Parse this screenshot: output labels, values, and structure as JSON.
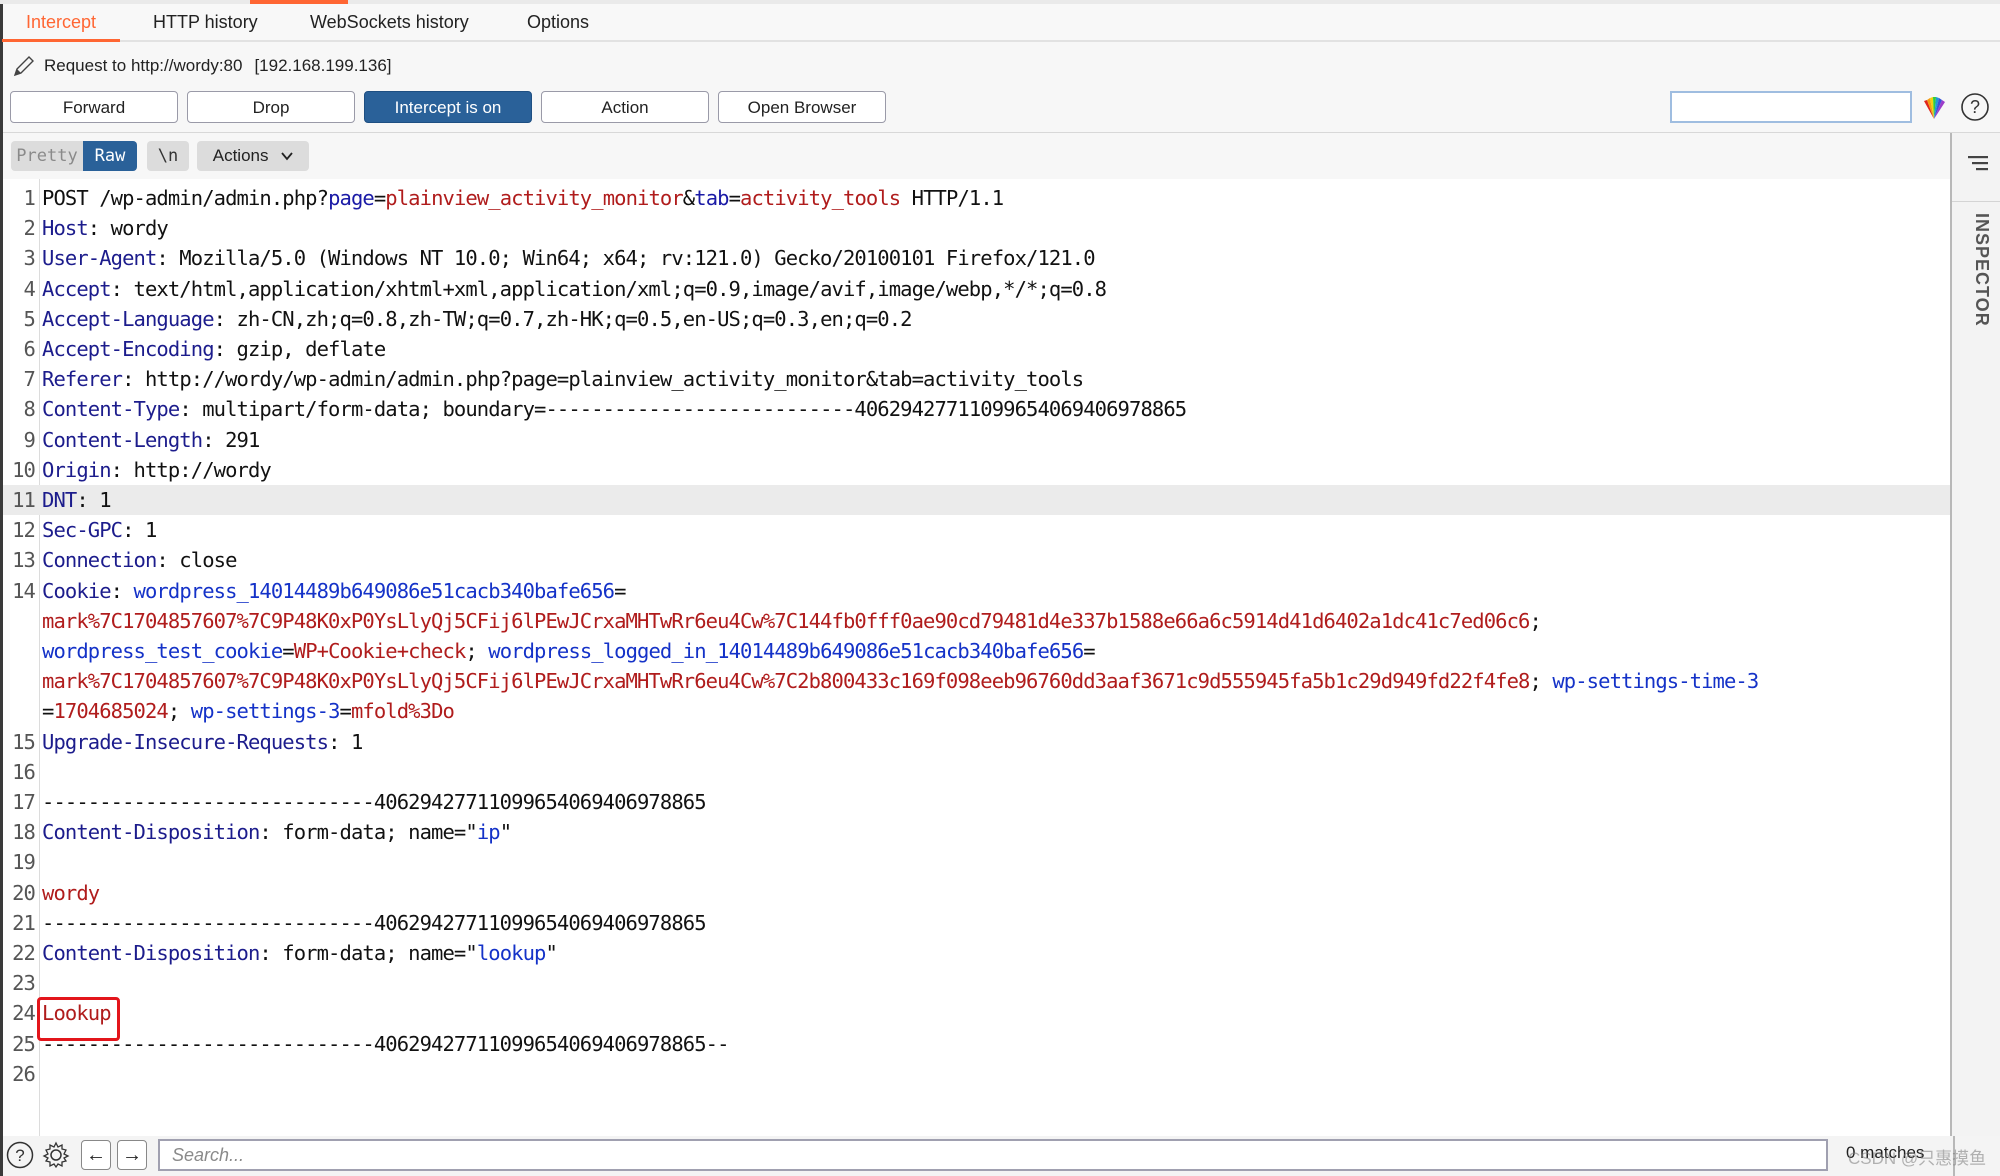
{
  "tabs": [
    {
      "label": "Intercept",
      "active": true
    },
    {
      "label": "HTTP history",
      "active": false
    },
    {
      "label": "WebSockets history",
      "active": false
    },
    {
      "label": "Options",
      "active": false
    }
  ],
  "request_info": {
    "label": "Request to http://wordy:80",
    "ip": "[192.168.199.136]"
  },
  "toolbar": {
    "forward": "Forward",
    "drop": "Drop",
    "intercept": "Intercept is on",
    "action": "Action",
    "open_browser": "Open Browser",
    "search_value": ""
  },
  "editor_toolbar": {
    "pretty": "Pretty",
    "raw": "Raw",
    "newline": "\\n",
    "actions": "Actions"
  },
  "lines": [
    {
      "n": "1",
      "segs": [
        [
          "dk",
          "POST /wp-admin/admin.php?"
        ],
        [
          "k",
          "page"
        ],
        [
          "dk",
          "="
        ],
        [
          "v",
          "plainview_activity_monitor"
        ],
        [
          "dk",
          "&"
        ],
        [
          "k",
          "tab"
        ],
        [
          "dk",
          "="
        ],
        [
          "v",
          "activity_tools"
        ],
        [
          "dk",
          " HTTP/1.1"
        ]
      ]
    },
    {
      "n": "2",
      "segs": [
        [
          "n",
          "Host"
        ],
        [
          "dk",
          ": wordy"
        ]
      ]
    },
    {
      "n": "3",
      "segs": [
        [
          "n",
          "User-Agent"
        ],
        [
          "dk",
          ": Mozilla/5.0 (Windows NT 10.0; Win64; x64; rv:121.0) Gecko/20100101 Firefox/121.0"
        ]
      ]
    },
    {
      "n": "4",
      "segs": [
        [
          "n",
          "Accept"
        ],
        [
          "dk",
          ": text/html,application/xhtml+xml,application/xml;q=0.9,image/avif,image/webp,*/*;q=0.8"
        ]
      ]
    },
    {
      "n": "5",
      "segs": [
        [
          "n",
          "Accept-Language"
        ],
        [
          "dk",
          ": zh-CN,zh;q=0.8,zh-TW;q=0.7,zh-HK;q=0.5,en-US;q=0.3,en;q=0.2"
        ]
      ]
    },
    {
      "n": "6",
      "segs": [
        [
          "n",
          "Accept-Encoding"
        ],
        [
          "dk",
          ": gzip, deflate"
        ]
      ]
    },
    {
      "n": "7",
      "segs": [
        [
          "n",
          "Referer"
        ],
        [
          "dk",
          ": http://wordy/wp-admin/admin.php?page=plainview_activity_monitor&tab=activity_tools"
        ]
      ]
    },
    {
      "n": "8",
      "segs": [
        [
          "n",
          "Content-Type"
        ],
        [
          "dk",
          ": multipart/form-data; boundary=---------------------------406294277110996540694069788​65"
        ]
      ]
    },
    {
      "n": "9",
      "segs": [
        [
          "n",
          "Content-Length"
        ],
        [
          "dk",
          ": 291"
        ]
      ]
    },
    {
      "n": "10",
      "segs": [
        [
          "n",
          "Origin"
        ],
        [
          "dk",
          ": http://wordy"
        ]
      ]
    },
    {
      "n": "11",
      "segs": [
        [
          "n",
          "DNT"
        ],
        [
          "dk",
          ": 1"
        ]
      ],
      "highlight": true
    },
    {
      "n": "12",
      "segs": [
        [
          "n",
          "Sec-GPC"
        ],
        [
          "dk",
          ": 1"
        ]
      ]
    },
    {
      "n": "13",
      "segs": [
        [
          "n",
          "Connection"
        ],
        [
          "dk",
          ": close"
        ]
      ]
    },
    {
      "n": "14",
      "segs": [
        [
          "n",
          "Cookie"
        ],
        [
          "dk",
          ": "
        ],
        [
          "blue",
          "wordpress_14014489b649086e51cacb340bafe656"
        ],
        [
          "dk",
          "="
        ]
      ]
    },
    {
      "n": "",
      "segs": [
        [
          "v",
          "mark%7C1704857607%7C9P48K0xP0YsLlyQj5CFij6lPEwJCrxaMHTwRr6eu4Cw%7C144fb0fff0ae90cd79481d4e337b1588e66a6c5914d41d6402a1dc41c7ed06c6"
        ],
        [
          "dk",
          ";"
        ]
      ]
    },
    {
      "n": "",
      "segs": [
        [
          "blue",
          "wordpress_test_cookie"
        ],
        [
          "dk",
          "="
        ],
        [
          "v",
          "WP+Cookie+check"
        ],
        [
          "dk",
          "; "
        ],
        [
          "blue",
          "wordpress_logged_in_14014489b649086e51cacb340bafe656"
        ],
        [
          "dk",
          "="
        ]
      ]
    },
    {
      "n": "",
      "segs": [
        [
          "v",
          "mark%7C1704857607%7C9P48K0xP0YsLlyQj5CFij6lPEwJCrxaMHTwRr6eu4Cw%7C2b800433c169f098eeb96760dd3aaf3671c9d555945fa5b1c29d949fd22f4fe8"
        ],
        [
          "dk",
          "; "
        ],
        [
          "blue",
          "wp-settings-time-3"
        ]
      ]
    },
    {
      "n": "",
      "segs": [
        [
          "dk",
          "="
        ],
        [
          "v",
          "1704685024"
        ],
        [
          "dk",
          "; "
        ],
        [
          "blue",
          "wp-settings-3"
        ],
        [
          "dk",
          "="
        ],
        [
          "v",
          "mfold%3Do"
        ]
      ]
    },
    {
      "n": "15",
      "segs": [
        [
          "n",
          "Upgrade-Insecure-Requests"
        ],
        [
          "dk",
          ": 1"
        ]
      ]
    },
    {
      "n": "16",
      "segs": []
    },
    {
      "n": "17",
      "segs": [
        [
          "dk",
          "-----------------------------40629427711099654069406978865"
        ]
      ]
    },
    {
      "n": "18",
      "segs": [
        [
          "n",
          "Content-Disposition"
        ],
        [
          "dk",
          ": form-data; name=\""
        ],
        [
          "blue",
          "ip"
        ],
        [
          "dk",
          "\""
        ]
      ]
    },
    {
      "n": "19",
      "segs": []
    },
    {
      "n": "20",
      "segs": [
        [
          "v",
          "wordy"
        ]
      ]
    },
    {
      "n": "21",
      "segs": [
        [
          "dk",
          "-----------------------------40629427711099654069406978865"
        ]
      ]
    },
    {
      "n": "22",
      "segs": [
        [
          "n",
          "Content-Disposition"
        ],
        [
          "dk",
          ": form-data; name=\""
        ],
        [
          "blue",
          "lookup"
        ],
        [
          "dk",
          "\""
        ]
      ]
    },
    {
      "n": "23",
      "segs": []
    },
    {
      "n": "24",
      "segs": [
        [
          "v",
          "Lookup"
        ]
      ]
    },
    {
      "n": "25",
      "segs": [
        [
          "dk",
          "-----------------------------40629427711099654069406978865--"
        ]
      ]
    },
    {
      "n": "26",
      "segs": []
    }
  ],
  "inspector": {
    "label": "INSPECTOR"
  },
  "bottom": {
    "search_placeholder": "Search...",
    "matches": "0 matches",
    "watermark": "CSDN @只惠摸鱼"
  },
  "icons": {
    "edit": "pencil-icon",
    "burp": "burp-fan-icon",
    "help": "help-icon",
    "settings": "gear-icon",
    "back": "arrow-left-icon",
    "forward": "arrow-right-icon",
    "inspector_menu": "menu-icon",
    "dropdown": "chevron-down-icon"
  },
  "colors": {
    "accent": "#ff6633",
    "primary_button": "#2a6199",
    "header_name": "#1c1c8c",
    "param_value": "#b01c1c",
    "highlight_box": "#e3151b"
  }
}
